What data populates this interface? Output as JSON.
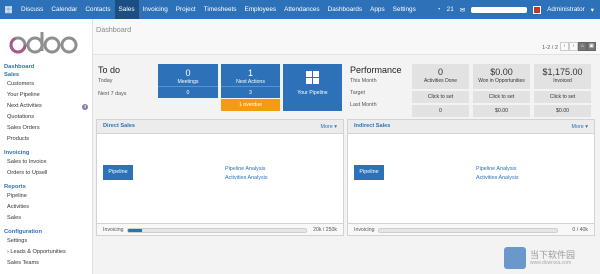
{
  "topbar": {
    "menu_icon": "grid-menu-icon",
    "nav": [
      "Discuss",
      "Calendar",
      "Contacts",
      "Sales",
      "Invoicing",
      "Project",
      "Timesheets",
      "Employees",
      "Attendances",
      "Dashboards",
      "Apps",
      "Settings"
    ],
    "active_nav": "Sales",
    "notif_count": "21",
    "user": "Administrator"
  },
  "sidebar": {
    "logo_text": "odoo",
    "sections": [
      {
        "head": "Dashboard",
        "items": []
      },
      {
        "head": "Sales",
        "items": [
          "Customers",
          "Your Pipeline",
          "Next Activities",
          "Quotations",
          "Sales Orders",
          "Products"
        ]
      },
      {
        "head": "Invoicing",
        "items": [
          "Sales to Invoice",
          "Orders to Upsell"
        ]
      },
      {
        "head": "Reports",
        "items": [
          "Pipeline",
          "Activities",
          "Sales"
        ]
      },
      {
        "head": "Configuration",
        "items": [
          "Settings",
          "Leads & Opportunities",
          "Sales Teams"
        ]
      }
    ],
    "next_activities_badge": "3"
  },
  "main": {
    "title": "Dashboard",
    "pager": "1-2 / 2",
    "pager_prev": "‹",
    "pager_next": "›",
    "todo": {
      "title": "To do",
      "today": "Today",
      "next7": "Next 7 days"
    },
    "meetings": {
      "num": "0",
      "label": "Meetings",
      "sub": "0"
    },
    "next_actions": {
      "num": "1",
      "label": "Next Actions",
      "sub": "3",
      "overdue": "1 overdue"
    },
    "pipeline_tile": {
      "label": "Your Pipeline"
    },
    "performance": {
      "title": "Performance",
      "this_month": "This Month",
      "target": "Target",
      "last_month": "Last Month"
    },
    "activities_done": {
      "num": "0",
      "label": "Activities Done",
      "target": "Click to set",
      "last": "0"
    },
    "won": {
      "num": "$0.00",
      "label": "Won in Opportunities",
      "target": "Click to set",
      "last": "$0.00"
    },
    "invoiced": {
      "num": "$1,175.00",
      "label": "Invoiced",
      "target": "Click to set",
      "last": "$0.00"
    },
    "panels": [
      {
        "title": "Direct Sales",
        "more": "More ▾",
        "button": "Pipeline",
        "link1": "Pipeline Analysis",
        "link2": "Activities Analysis",
        "foot_label": "Invoicing",
        "foot_value": "20k / 250k",
        "progress": 0.08
      },
      {
        "title": "Indirect Sales",
        "more": "More ▾",
        "button": "Pipeline",
        "link1": "Pipeline Analysis",
        "link2": "Activities Analysis",
        "foot_label": "Invoicing",
        "foot_value": "0 / 40k",
        "progress": 0
      }
    ]
  },
  "watermark": {
    "text": "当下软件园",
    "url": "www.downxia.com"
  }
}
